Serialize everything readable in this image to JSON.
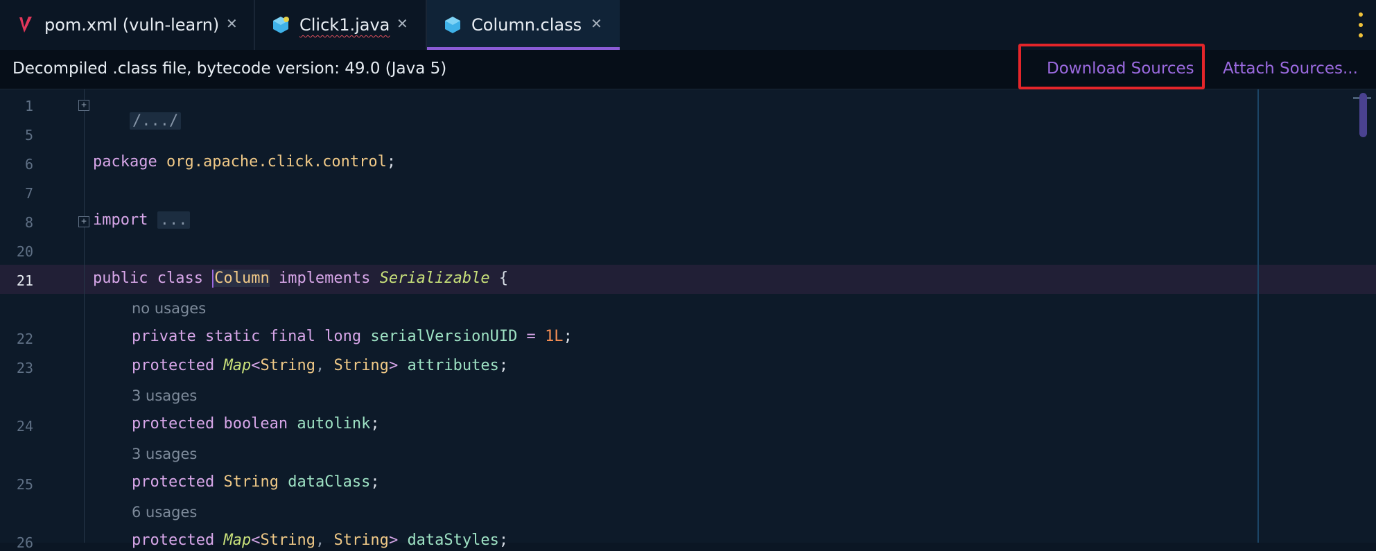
{
  "tabs": [
    {
      "label": "pom.xml (vuln-learn)",
      "icon": "maven-icon",
      "active": false
    },
    {
      "label": "Click1.java",
      "icon": "java-class-icon",
      "active": false,
      "error": true
    },
    {
      "label": "Column.class",
      "icon": "class-file-icon",
      "active": true
    }
  ],
  "close_glyph": "✕",
  "banner": {
    "text": "Decompiled .class file, bytecode version: 49.0 (Java 5)",
    "download_sources": "Download Sources",
    "attach_sources": "Attach Sources..."
  },
  "editor": {
    "line_numbers": [
      "1",
      "5",
      "6",
      "7",
      "8",
      "20",
      "21",
      "22",
      "23",
      "24",
      "25",
      "26"
    ],
    "current_line": "21",
    "folded_header": "/.../",
    "package_kw": "package",
    "package_name": "org.apache.click.control",
    "import_kw": "import",
    "import_folded": "...",
    "class_decl": {
      "kw1": "public",
      "kw2": "class",
      "name": "Column",
      "kw3": "implements",
      "iface": "Serializable",
      "brace": "{"
    },
    "hints": [
      "no usages",
      "3 usages",
      "3 usages",
      "6 usages"
    ],
    "fields": [
      {
        "mods": "private static final long",
        "name": "serialVersionUID",
        "rest_op": " = ",
        "value": "1L",
        "end": ";"
      },
      {
        "mods": "protected",
        "type_italic": "Map",
        "generic": [
          "String",
          "String"
        ],
        "name": "attributes",
        "end": ";"
      },
      {
        "mods": "protected boolean",
        "name": "autolink",
        "end": ";"
      },
      {
        "mods": "protected",
        "type": "String",
        "name": "dataClass",
        "end": ";"
      },
      {
        "mods": "protected",
        "type_italic": "Map",
        "generic": [
          "String",
          "String"
        ],
        "name": "dataStyles",
        "end": ";"
      }
    ]
  },
  "colors": {
    "accent": "#8b5cd6",
    "link": "#9b6ae0",
    "highlight_box": "#e4252a"
  }
}
